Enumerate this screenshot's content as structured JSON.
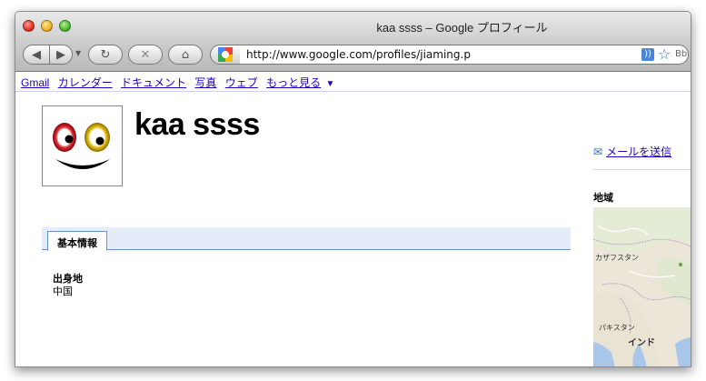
{
  "window": {
    "title": "kaa ssss – Google プロフィール",
    "url": "http://www.google.com/profiles/jiaming.p"
  },
  "nav_icons": {
    "back": "◀",
    "forward": "▶",
    "dropdown": "▼",
    "reload": "↻",
    "stop": "✕",
    "home": "⌂",
    "rss": "))",
    "star": "☆",
    "bookmark": "Bb"
  },
  "gbar": {
    "items": [
      "Gmail",
      "カレンダー",
      "ドキュメント",
      "写真",
      "ウェブ",
      "もっと見る"
    ],
    "more_arrow": "▼"
  },
  "profile": {
    "name": "kaa ssss"
  },
  "tabs": [
    {
      "label": "基本情報",
      "active": true
    }
  ],
  "basic_info": {
    "label": "出身地",
    "value": "中国"
  },
  "sidebar": {
    "mail_icon": "✉",
    "send_mail": "メールを送信",
    "region_title": "地域",
    "map_labels": [
      "カザフスタン",
      "パキスタン",
      "インド"
    ]
  },
  "colors": {
    "link": "#2200cc",
    "tab_bg": "#e5ecf9",
    "tab_border": "#6b90da"
  }
}
